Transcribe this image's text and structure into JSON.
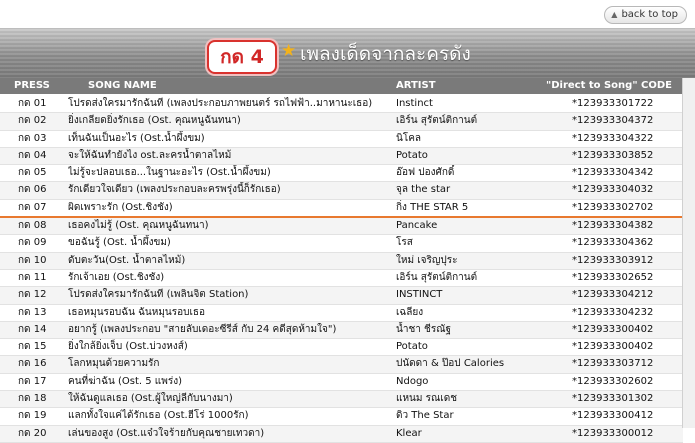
{
  "nav": {
    "back_label": "back to top"
  },
  "banner": {
    "badge": "กด 4",
    "title": "เพลงเด็ดจากละครดัง"
  },
  "table": {
    "headers": {
      "press": "PRESS",
      "song": "SONG NAME",
      "artist": "ARTIST",
      "code": "\"Direct to Song\" CODE"
    },
    "rows": [
      {
        "press": "กด 01",
        "song": "โปรดส่งใครมารักฉันที (เพลงประกอบภาพยนตร์ รถไฟฟ้า..มาหานะเธอ)",
        "artist": "Instinct",
        "code": "*123933301722"
      },
      {
        "press": "กด 02",
        "song": "ยิ่งเกลียดยิ่งรักเธอ (Ost. คุณหนูฉันทนา)",
        "artist": "เอิร์น สุรัตน์ติกานต์",
        "code": "*123933304372"
      },
      {
        "press": "กด 03",
        "song": "เท็นฉันเป็นอะไร (Ost.น้ำผึ้งขม)",
        "artist": "นิโคล",
        "code": "*123933304322"
      },
      {
        "press": "กด 04",
        "song": "จะให้ฉันทำยังไง ost.ละครน้ำตาลไหม้",
        "artist": "Potato",
        "code": "*123933303852"
      },
      {
        "press": "กด 05",
        "song": "ไม่รู้จะปลอบเธอ...ในฐานะอะไร (Ost.น้ำผึ้งขม)",
        "artist": "อ๊อฟ ปองศักดิ์",
        "code": "*123933304342"
      },
      {
        "press": "กด 06",
        "song": "รักเดียวใจเดียว (เพลงประกอบละครพรุ่งนี้ก็รักเธอ)",
        "artist": "จุล the star",
        "code": "*123933304032"
      },
      {
        "press": "กด 07",
        "song": "ผิดเพราะรัก (Ost.ชิงชัง)",
        "artist": "กิ่ง THE STAR 5",
        "code": "*123933302702"
      },
      {
        "press": "กด 08",
        "song": "เธอคงไม่รู้ (Ost. คุณหนูฉันทนา)",
        "artist": "Pancake",
        "code": "*123933304382"
      },
      {
        "press": "กด 09",
        "song": "ขอฉันรู้ (Ost. น้ำผึ้งขม)",
        "artist": "โรส",
        "code": "*123933304362"
      },
      {
        "press": "กด 10",
        "song": "ดับตะวัน(Ost. น้ำตาลไหม้)",
        "artist": "ใหม่ เจริญปุระ",
        "code": "*123933303912"
      },
      {
        "press": "กด 11",
        "song": "รักเจ้าเอย (Ost.ชิงชัง)",
        "artist": "เอิร์น สุรัตน์ติกานต์",
        "code": "*123933302652"
      },
      {
        "press": "กด 12",
        "song": "โปรดส่งใครมารักฉันที (เพลินจิต Station)",
        "artist": "INSTINCT",
        "code": "*123933304212"
      },
      {
        "press": "กด 13",
        "song": "เธอหมุนรอบฉัน ฉันหมุนรอบเธอ",
        "artist": "เฉลียง",
        "code": "*123933304232"
      },
      {
        "press": "กด 14",
        "song": "อยากรู้ (เพลงประกอบ \"สายลับเดอะซีรีส์ กับ 24 คดีสุดห้ามใจ\")",
        "artist": "น้ำชา ชีรณัฐ",
        "code": "*123933300402"
      },
      {
        "press": "กด 15",
        "song": "ยิ่งใกล้ยิ่งเจ็บ (Ost.บ่วงหงส์)",
        "artist": "Potato",
        "code": "*123933300402"
      },
      {
        "press": "กด 16",
        "song": "โลกหมุนด้วยความรัก",
        "artist": "ปนัดดา & ป๊อป Calories",
        "code": "*123933303712"
      },
      {
        "press": "กด 17",
        "song": "คนที่ฆ่าฉัน (Ost. 5 แพร่ง)",
        "artist": "Ndogo",
        "code": "*123933302602"
      },
      {
        "press": "กด 18",
        "song": "ให้ฉันดูแลเธอ (Ost.ผู้ใหญ่ลีกับนางมา)",
        "artist": "แหนม รณเดช",
        "code": "*123933301302"
      },
      {
        "press": "กด 19",
        "song": "แลกทั้งใจแค่ได้รักเธอ (Ost.ฮีโร่ 1000รัก)",
        "artist": "ดิว The Star",
        "code": "*123933300412"
      },
      {
        "press": "กด 20",
        "song": "เล่นของสูง (Ost.แจ๋วใจร้ายกับคุณชายเทวดา)",
        "artist": "Klear",
        "code": "*123933300012"
      }
    ]
  },
  "colors": {
    "badge_red": "#d12727",
    "star": "#f3b21a",
    "header_gray": "#7a7a7a",
    "highlight_line": "#e8792f"
  }
}
